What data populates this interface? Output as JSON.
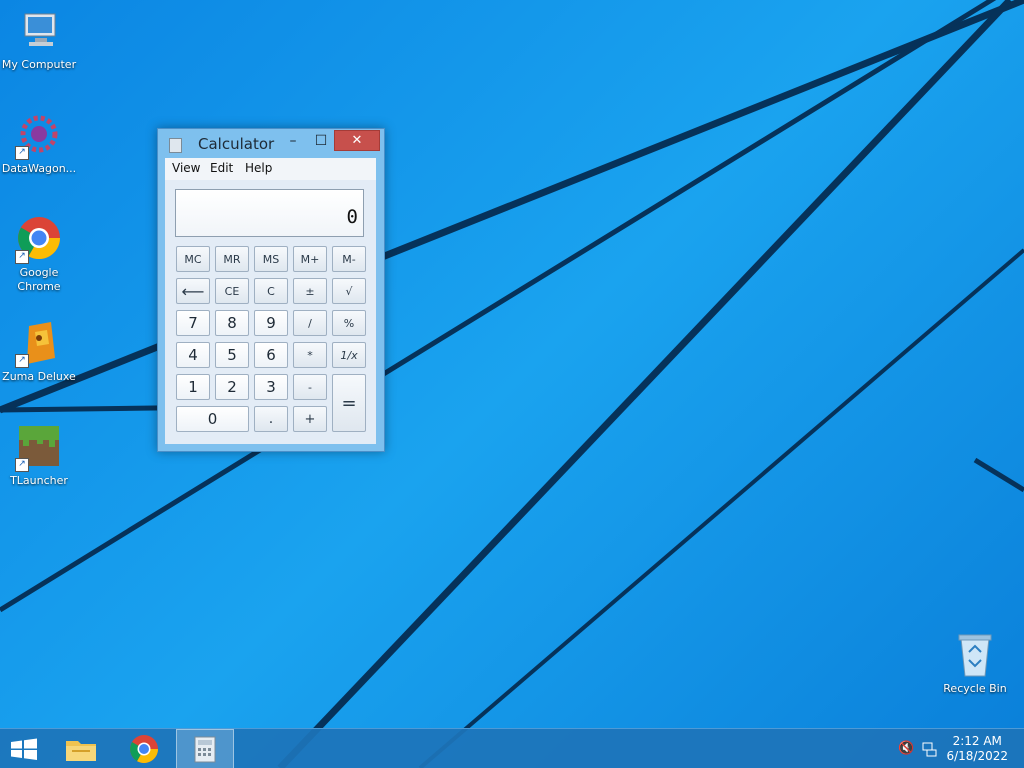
{
  "desktop": {
    "icons": [
      {
        "label": "My Computer"
      },
      {
        "label": "DataWagon..."
      },
      {
        "label": "Google\nChrome"
      },
      {
        "label": "Zuma Deluxe"
      },
      {
        "label": "TLauncher"
      },
      {
        "label": "Recycle Bin"
      }
    ]
  },
  "calculator": {
    "title": "Calculator",
    "minimize": "–",
    "maximize": "☐",
    "close": "✕",
    "menu": [
      "View",
      "Edit",
      "Help"
    ],
    "display": "0",
    "keys": {
      "mc": "MC",
      "mr": "MR",
      "ms": "MS",
      "mplus": "M+",
      "mminus": "M-",
      "back": "⟵",
      "ce": "CE",
      "c": "C",
      "plusminus": "±",
      "sqrt": "√",
      "k7": "7",
      "k8": "8",
      "k9": "9",
      "div": "/",
      "pct": "%",
      "k4": "4",
      "k5": "5",
      "k6": "6",
      "mul": "*",
      "recip": "1/x",
      "k1": "1",
      "k2": "2",
      "k3": "3",
      "sub": "-",
      "k0": "0",
      "dot": ".",
      "add": "+",
      "eq": "="
    }
  },
  "taskbar": {
    "start": "start-icon",
    "apps": [
      "file-explorer-icon",
      "chrome-icon",
      "calculator-icon"
    ],
    "tray": {
      "volume": "🔇",
      "network": "network-icon"
    },
    "time": "2:12 AM",
    "date": "6/18/2022"
  },
  "colors": {
    "accent": "#1d74ba",
    "close": "#c7504c",
    "desktop": "#0b86e3"
  }
}
